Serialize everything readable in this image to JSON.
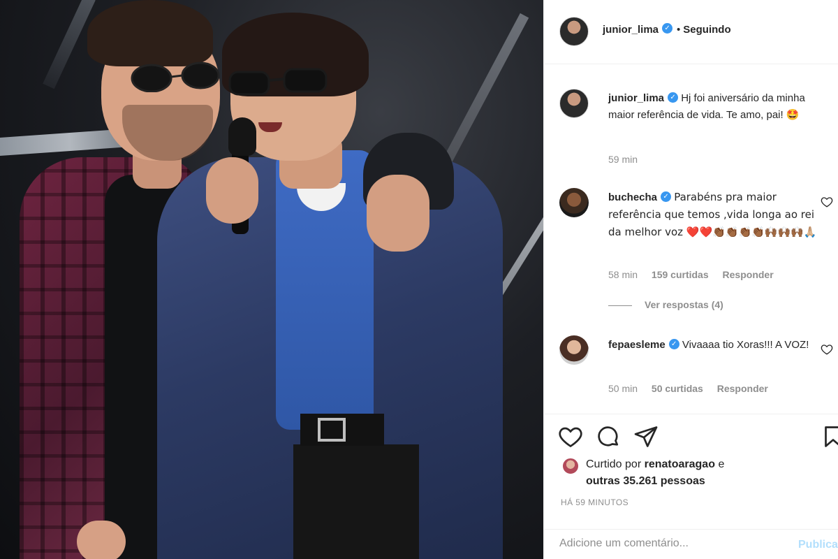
{
  "post": {
    "author": "junior_lima",
    "follow_status": "Seguindo",
    "caption": "Hj foi aniversário da minha maior referência de vida. Te amo, pai! 🤩",
    "caption_time": "59 min"
  },
  "comments": [
    {
      "user": "buchecha",
      "text": "Parabéns pra maior referência que temos ,vida longa ao rei da melhor voz ❤️❤️👏🏾👏🏾👏🏾👏🏾🙌🏾🙌🏾🙌🏾🙏🏼",
      "time": "58 min",
      "likes": "159 curtidas",
      "reply": "Responder",
      "view_replies": "Ver respostas (4)"
    },
    {
      "user": "fepaesleme",
      "text": "Vivaaaa tio Xoras!!! A VOZ!",
      "time": "50 min",
      "likes": "50 curtidas",
      "reply": "Responder"
    }
  ],
  "likes": {
    "prefix": "Curtido por",
    "user": "renatoaragao",
    "connector": "e",
    "others": "outras 35.261 pessoas"
  },
  "timestamp": "HÁ 59 MINUTOS",
  "comment_box": {
    "placeholder": "Adicione um comentário...",
    "publish_label": "Publicar"
  },
  "icons": {
    "verified": "verified-badge-icon",
    "like": "heart-icon",
    "comment": "comment-bubble-icon",
    "share": "paper-plane-icon",
    "save": "bookmark-icon"
  },
  "colors": {
    "verified": "#3897f0",
    "muted": "#8e8e8e",
    "text": "#262626",
    "publish_disabled": "#b2dffc"
  }
}
